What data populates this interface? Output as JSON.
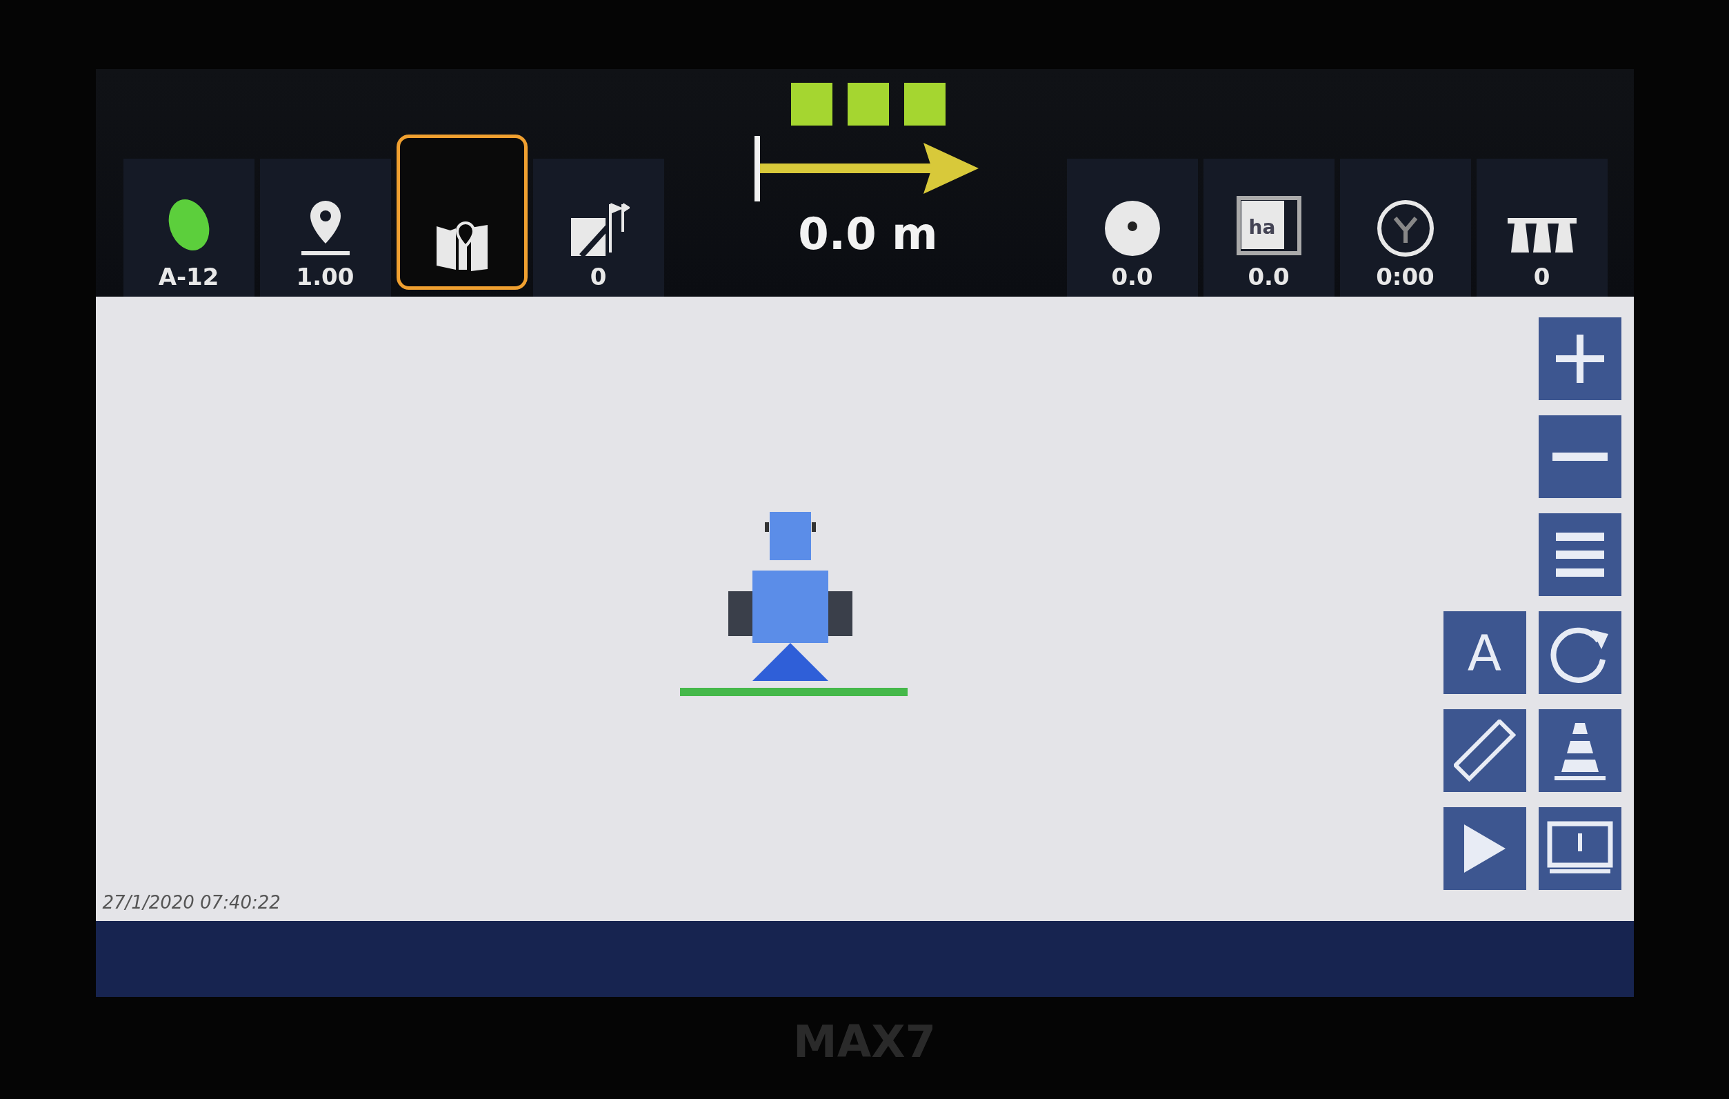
{
  "top_bar": {
    "left_items": [
      {
        "kind": "gnss",
        "value": "A-12",
        "selected": false
      },
      {
        "kind": "pin",
        "value": "1.00",
        "selected": false
      },
      {
        "kind": "field-map",
        "selected": true
      },
      {
        "kind": "boundary",
        "value": "0",
        "selected": false
      }
    ],
    "sections": [
      {
        "on": true
      },
      {
        "on": true
      },
      {
        "on": true
      }
    ],
    "guidance": {
      "distance": "0.0 m"
    },
    "right_items": [
      {
        "kind": "speedo",
        "value": "0.0"
      },
      {
        "kind": "area",
        "icon_text": "ha",
        "value": "0.0"
      },
      {
        "kind": "clock",
        "value": "0:00"
      },
      {
        "kind": "nozzles",
        "value": "0"
      }
    ]
  },
  "map": {
    "timestamp": "27/1/2020 07:40:22",
    "tools": [
      {
        "kind": "zoom-in"
      },
      {
        "kind": "zoom-out"
      },
      {
        "kind": "menu"
      },
      {
        "kind": "auto",
        "text": "A"
      },
      {
        "kind": "rotate"
      },
      {
        "kind": "ruler"
      },
      {
        "kind": "cone"
      },
      {
        "kind": "play"
      },
      {
        "kind": "monitor"
      }
    ]
  },
  "bezel": {
    "model": "MAX7"
  }
}
